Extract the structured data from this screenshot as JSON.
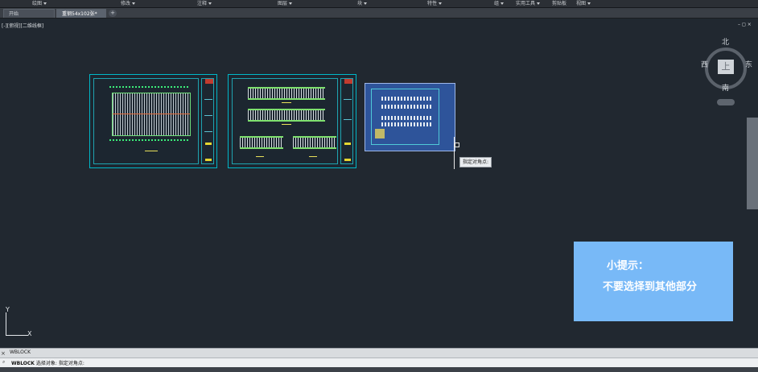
{
  "ribbon": {
    "panels": [
      "绘图",
      "修改",
      "注释",
      "图层",
      "块",
      "特性",
      "组",
      "实用工具",
      "剪贴板",
      "视图"
    ]
  },
  "tabs": [
    {
      "label": "开始",
      "active": false
    },
    {
      "label": "重钢54x102张*",
      "active": true
    }
  ],
  "tab_add": "+",
  "viewport": {
    "label": "[-][俯视][二维线框]",
    "controls": "–  ◻  ×"
  },
  "tooltip": "指定对角点:",
  "viewcube": {
    "north": "北",
    "south": "南",
    "east": "东",
    "west": "西",
    "face": "上"
  },
  "hint": {
    "title": "小提示：",
    "body": "不要选择到其他部分"
  },
  "ucs": {
    "x": "X",
    "y": "Y"
  },
  "command": {
    "history": "WBLOCK",
    "prompt_cmd": "WBLOCK",
    "prompt_text": "选择对象: 指定对角点:",
    "close": "×",
    "icon": "⌕"
  },
  "colors": {
    "background": "#212830",
    "selection": "#3466c8",
    "hint_bg": "#78b9f7",
    "sheet_border": "#00b7c8"
  }
}
